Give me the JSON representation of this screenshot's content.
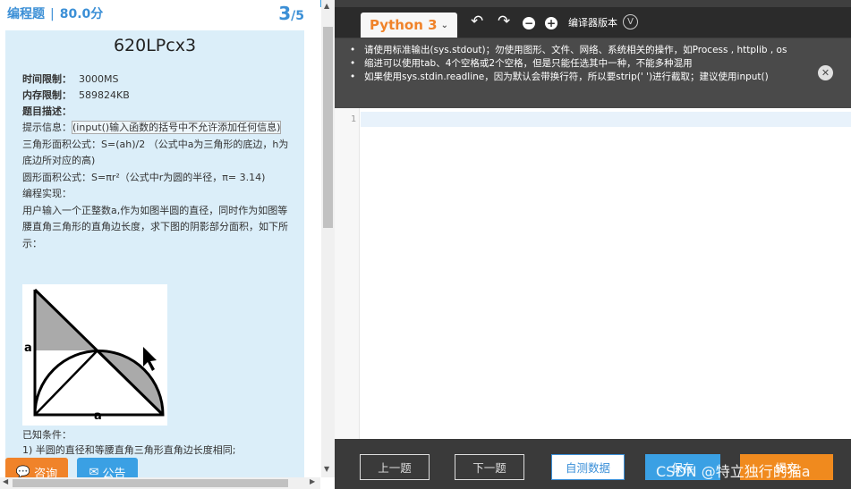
{
  "header": {
    "question_type": "编程题",
    "separator": "|",
    "score": "80.0分",
    "current": "3",
    "total": "/5"
  },
  "problem": {
    "title": "620LPcx3",
    "time_limit_label": "时间限制：",
    "time_limit": "3000MS",
    "memory_limit_label": "内存限制：",
    "memory_limit": "589824KB",
    "desc_label": "题目描述：",
    "tip_prefix": "提示信息：",
    "tip": "(input()输入函数的括号中不允许添加任何信息)",
    "line_triangle": "三角形面积公式：S=(ah)/2 （公式中a为三角形的底边，h为底边所对应的高)",
    "line_circle": "圆形面积公式：S=πr²（公式中r为圆的半径，π= 3.14)",
    "line_impl": "编程实现：",
    "line_task": "用户输入一个正整数a,作为如图半圆的直径，同时作为如图等腰直角三角形的直角边长度，求下图的阴影部分面积，如下所示：",
    "figure_label_left": "a",
    "figure_label_bottom": "a",
    "known_label": "已知条件：",
    "known_1": "1) 半圆的直径和等腰直角三角形直角边长度相同;"
  },
  "footer_buttons": {
    "consult": "咨询",
    "notice": "公告"
  },
  "editor": {
    "language": "Python 3",
    "compiler_version": "编译器版本",
    "notices": [
      "请使用标准输出(sys.stdout)；勿使用图形、文件、网络、系统相关的操作，如Process , httplib , os",
      "缩进可以使用tab、4个空格或2个空格，但是只能任选其中一种，不能多种混用",
      "如果使用sys.stdin.readline，因为默认会带换行符，所以要strip(' ')进行截取；建议使用input()"
    ],
    "line_number": "1"
  },
  "bottom_buttons": {
    "prev": "上一题",
    "next": "下一题",
    "self_test": "自测数据",
    "save": "保存",
    "submit": "提交"
  },
  "watermark": "CSDN @特立独行的猫a",
  "colors": {
    "accent_blue": "#3aa0e4",
    "accent_orange": "#f0832a",
    "panel_bg": "#dbeef9",
    "editor_dark": "#3f3f3f"
  }
}
